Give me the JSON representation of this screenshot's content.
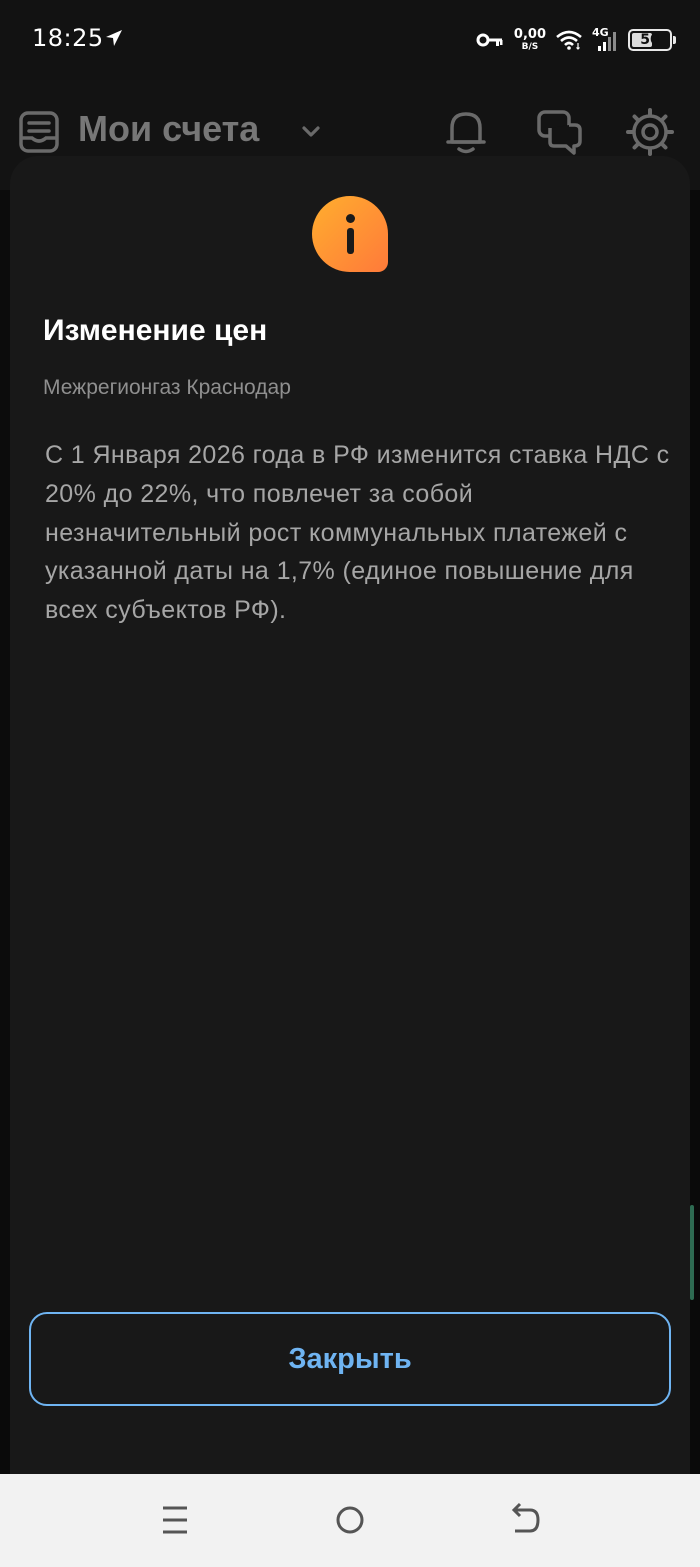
{
  "status_bar": {
    "time": "18:25",
    "net_speed_value": "0,00",
    "net_speed_unit": "B/S",
    "network_type": "4G",
    "battery_level": "50",
    "icons": [
      "navigation-arrow-icon",
      "vpn-key-icon",
      "wifi-icon",
      "signal-icon",
      "battery-icon"
    ]
  },
  "header": {
    "title": "Мои счета",
    "icons": [
      "accounts-list-icon",
      "chevron-down-icon",
      "bell-icon",
      "chat-icon",
      "settings-icon"
    ]
  },
  "dialog": {
    "icon": "info-icon",
    "title": "Изменение цен",
    "subtitle": "Межрегионгаз Краснодар",
    "body": "С 1 Января 2026 года в РФ изменится ставка НДС с 20% до 22%, что повлечет за собой незначительный рост коммунальных платежей с указанной даты на 1,7% (единое повышение для всех субъектов РФ).",
    "close_label": "Закрыть",
    "accent_color": "#6fb4f2"
  },
  "nav_bar": {
    "icons": [
      "menu-icon",
      "home-icon",
      "back-icon"
    ]
  }
}
